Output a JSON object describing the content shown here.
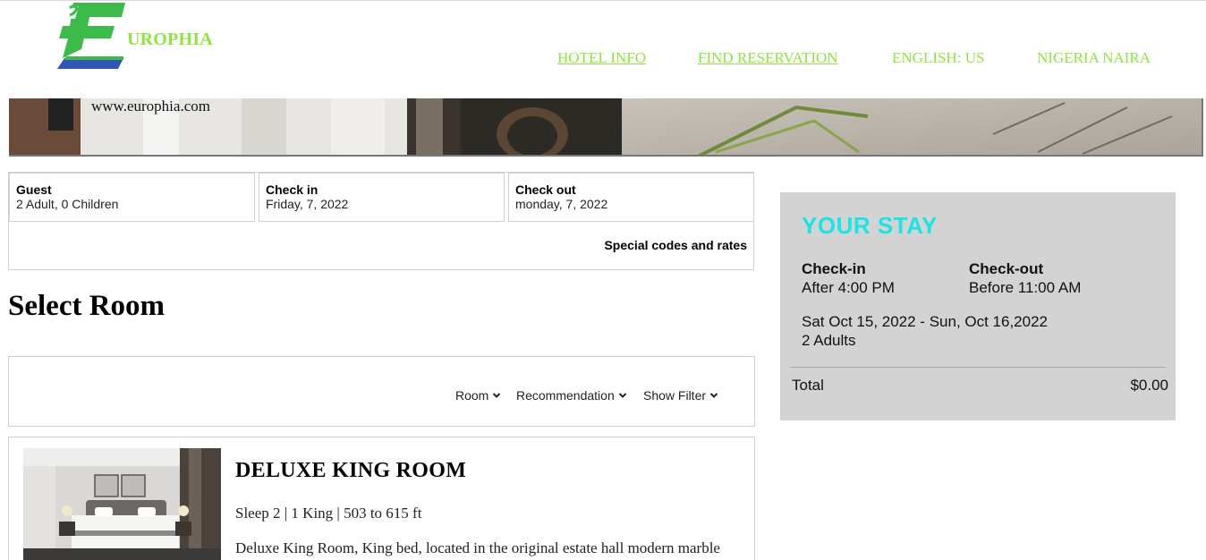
{
  "header": {
    "brand": "UROPHIA",
    "nav": [
      {
        "label": "HOTEL INFO"
      },
      {
        "label": "FIND RESERVATION"
      },
      {
        "label": "ENGLISH: US"
      },
      {
        "label": "NIGERIA NAIRA"
      }
    ]
  },
  "banner": {
    "url": "www.europhia.com"
  },
  "booking": {
    "guest": {
      "label": "Guest",
      "value": "2 Adult, 0 Children"
    },
    "checkin": {
      "label": "Check in",
      "value": "Friday, 7, 2022"
    },
    "checkout": {
      "label": "Check out",
      "value": "monday, 7, 2022"
    },
    "special": "Special codes and rates"
  },
  "main": {
    "title": "Select Room",
    "filters": [
      {
        "label": "Room",
        "icon": "chevron-down-icon"
      },
      {
        "label": "Recommendation",
        "icon": "chevron-down-icon"
      },
      {
        "label": "Show Filter",
        "icon": "chevron-down-icon"
      }
    ]
  },
  "room": {
    "title": "DELUXE KING ROOM",
    "specs": "Sleep 2 | 1 King | 503 to 615 ft",
    "description": "Deluxe King Room, King bed, located in the original estate hall modern marble"
  },
  "stay": {
    "title": "YOUR STAY",
    "checkin_label": "Check-in",
    "checkin_value": "After 4:00 PM",
    "checkout_label": "Check-out",
    "checkout_value": "Before 11:00 AM",
    "dates": "Sat Oct 15, 2022 - Sun, Oct 16,2022",
    "guests": "2 Adults",
    "total_label": "Total",
    "total_value": "$0.00"
  },
  "colors": {
    "brand_green": "#8ee53f",
    "logo_green": "#3dbb4a",
    "logo_blue": "#2f56b8",
    "stay_title": "#19e5e5",
    "stay_bg": "#d3d3d3"
  }
}
